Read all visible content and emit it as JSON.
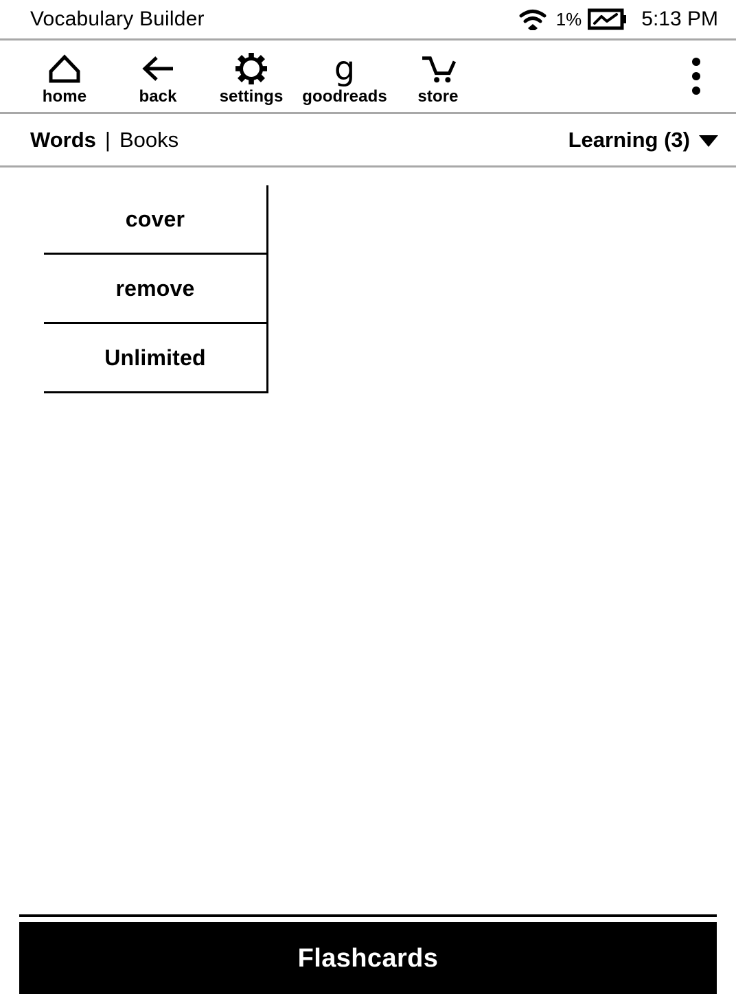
{
  "status_bar": {
    "title": "Vocabulary Builder",
    "wifi_icon": "wifi-icon",
    "battery_percent": "1%",
    "battery_icon": "battery-charging-icon",
    "time": "5:13 PM"
  },
  "toolbar": {
    "items": [
      {
        "label": "home",
        "icon": "home-icon"
      },
      {
        "label": "back",
        "icon": "back-arrow-icon"
      },
      {
        "label": "settings",
        "icon": "gear-icon"
      },
      {
        "label": "goodreads",
        "icon": "goodreads-g-icon",
        "glyph": "g"
      },
      {
        "label": "store",
        "icon": "shopping-cart-icon"
      }
    ],
    "overflow_icon": "overflow-menu-icon"
  },
  "tabs": {
    "items": [
      {
        "label": "Words",
        "active": true
      },
      {
        "label": "Books",
        "active": false
      }
    ],
    "separator": "|"
  },
  "filter": {
    "label": "Learning (3)",
    "caret_icon": "chevron-down-icon"
  },
  "word_list": {
    "words": [
      {
        "word": "cover"
      },
      {
        "word": "remove"
      },
      {
        "word": "Unlimited"
      }
    ]
  },
  "bottom_bar": {
    "flashcards_label": "Flashcards"
  },
  "colors": {
    "background": "#ffffff",
    "foreground": "#000000",
    "divider": "#a8a8a8",
    "bar_background": "#000000",
    "bar_text": "#ffffff"
  }
}
